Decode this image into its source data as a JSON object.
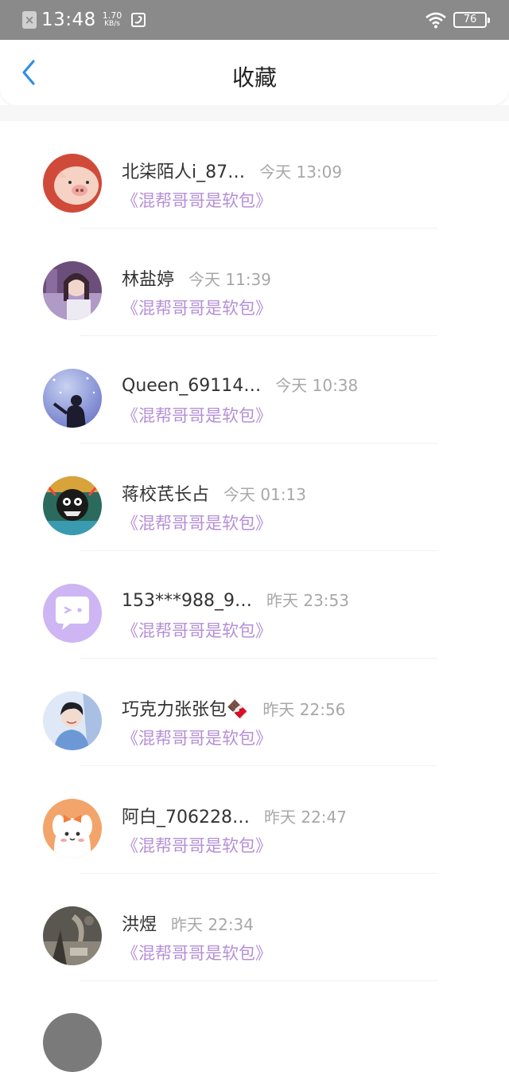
{
  "status_bar": {
    "time": "13:48",
    "speed_value": "1.70",
    "speed_unit": "KB/s",
    "battery": "76"
  },
  "header": {
    "title": "收藏"
  },
  "items": [
    {
      "name": "北柒陌人i_87…",
      "time": "今天 13:09",
      "book": "《混帮哥哥是软包》"
    },
    {
      "name": "林盐婷",
      "time": "今天 11:39",
      "book": "《混帮哥哥是软包》"
    },
    {
      "name": "Queen_69114…",
      "time": "今天 10:38",
      "book": "《混帮哥哥是软包》"
    },
    {
      "name": "蒋校芪长占",
      "time": "今天 01:13",
      "book": "《混帮哥哥是软包》"
    },
    {
      "name": "153***988_9…",
      "time": "昨天 23:53",
      "book": "《混帮哥哥是软包》"
    },
    {
      "name": "巧克力张张包🍫",
      "time": "昨天 22:56",
      "book": "《混帮哥哥是软包》"
    },
    {
      "name": "阿白_706228…",
      "time": "昨天 22:47",
      "book": "《混帮哥哥是软包》"
    },
    {
      "name": "洪煜",
      "time": "昨天 22:34",
      "book": "《混帮哥哥是软包》"
    }
  ],
  "colors": {
    "accent_back": "#2e8fe8",
    "book_title": "#b58fd6",
    "status_bar": "#8a8a8a"
  }
}
